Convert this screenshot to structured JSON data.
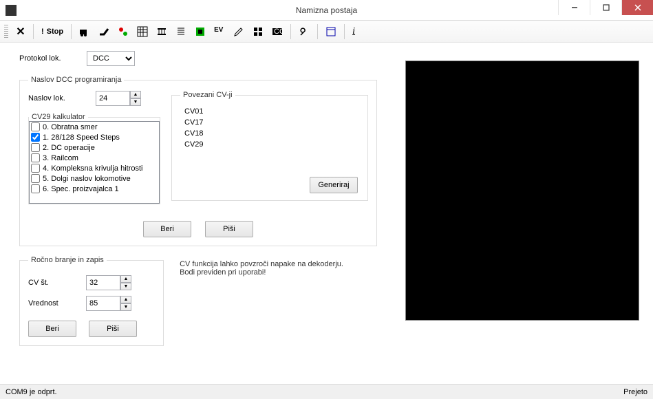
{
  "window": {
    "title": "Namizna postaja"
  },
  "toolbar": {
    "stop_label": "Stop"
  },
  "protocol": {
    "label": "Protokol lok.",
    "value": "DCC"
  },
  "dcc_group": {
    "legend": "Naslov DCC programiranja",
    "addr_label": "Naslov lok.",
    "addr_value": "24",
    "cv29": {
      "legend": "CV29 kalkulator",
      "items": [
        {
          "label": "0. Obratna smer",
          "checked": false
        },
        {
          "label": "1. 28/128 Speed Steps",
          "checked": true
        },
        {
          "label": "2. DC operacije",
          "checked": false
        },
        {
          "label": "3. Railcom",
          "checked": false
        },
        {
          "label": "4. Kompleksna krivulja hitrosti",
          "checked": false
        },
        {
          "label": "5. Dolgi naslov lokomotive",
          "checked": false
        },
        {
          "label": "6. Spec. proizvajalca 1",
          "checked": false
        }
      ]
    },
    "linked": {
      "legend": "Povezani CV-ji",
      "items": [
        "CV01",
        "CV17",
        "CV18",
        "CV29"
      ],
      "generate": "Generiraj"
    },
    "read": "Beri",
    "write": "Piši"
  },
  "manual": {
    "legend": "Ročno branje in zapis",
    "cv_label": "CV št.",
    "cv_value": "32",
    "val_label": "Vrednost",
    "val_value": "85",
    "read": "Beri",
    "write": "Piši"
  },
  "warning": {
    "line1": "CV funkcija lahko povzroči napake na dekoderju.",
    "line2": "Bodi previden pri uporabi!"
  },
  "status": {
    "left": "COM9 je odprt.",
    "right": "Prejeto"
  }
}
